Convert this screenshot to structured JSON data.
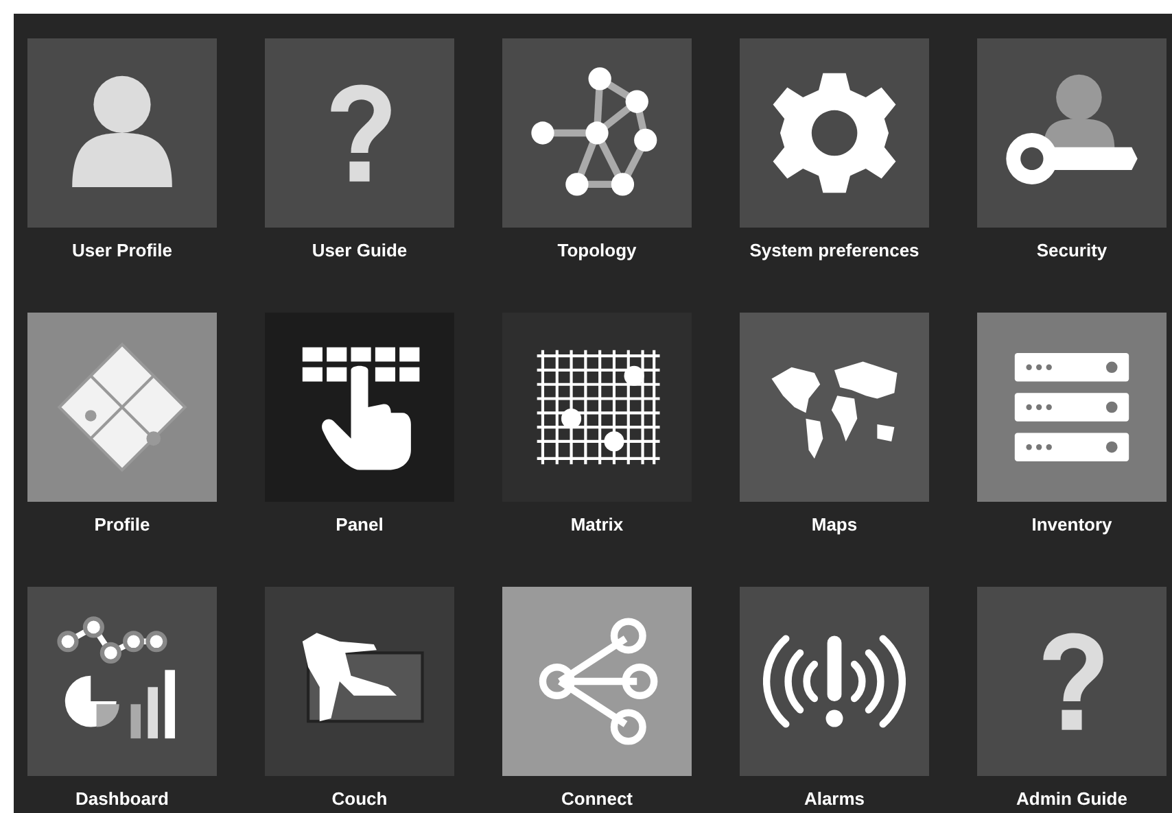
{
  "tiles": [
    {
      "label": "User Profile",
      "kind": "user",
      "color": "#4a4a4a"
    },
    {
      "label": "User Guide",
      "kind": "question",
      "color": "#4a4a4a"
    },
    {
      "label": "Topology",
      "kind": "topology",
      "color": "#4a4a4a"
    },
    {
      "label": "System preferences",
      "kind": "gear",
      "color": "#4a4a4a"
    },
    {
      "label": "Security",
      "kind": "security",
      "color": "#4a4a4a"
    },
    {
      "label": "Profile",
      "kind": "puzzle",
      "color": "#8a8a8a"
    },
    {
      "label": "Panel",
      "kind": "keypad",
      "color": "#1c1c1c"
    },
    {
      "label": "Matrix",
      "kind": "matrix",
      "color": "#2e2e2e"
    },
    {
      "label": "Maps",
      "kind": "map",
      "color": "#555555"
    },
    {
      "label": "Inventory",
      "kind": "servers",
      "color": "#7a7a7a"
    },
    {
      "label": "Dashboard",
      "kind": "dashboard",
      "color": "#4a4a4a"
    },
    {
      "label": "Couch",
      "kind": "couch",
      "color": "#3a3a3a"
    },
    {
      "label": "Connect",
      "kind": "share",
      "color": "#9a9a9a"
    },
    {
      "label": "Alarms",
      "kind": "alarm",
      "color": "#4a4a4a"
    },
    {
      "label": "Admin Guide",
      "kind": "question",
      "color": "#4a4a4a"
    }
  ]
}
